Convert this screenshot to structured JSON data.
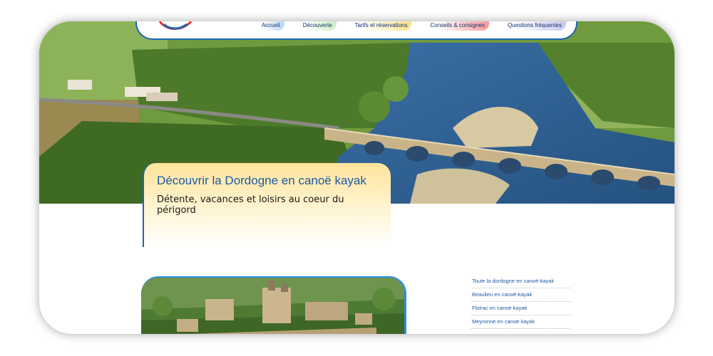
{
  "nav": {
    "items": [
      {
        "label": "Accueil",
        "key": "accueil"
      },
      {
        "label": "Découverte",
        "key": "decouverte"
      },
      {
        "label": "Tarifs et réservations",
        "key": "tarifs"
      },
      {
        "label": "Conseils & consignes",
        "key": "conseils"
      },
      {
        "label": "Questions fréquentes",
        "key": "questions"
      }
    ],
    "accent_colors": [
      "#b5d6f5",
      "#c9efc2",
      "#f8e38c",
      "#f49a9a",
      "#c9c9f2"
    ]
  },
  "hero": {
    "title": "Découvrir la Dordogne en canoë kayak",
    "subtitle": "Détente, vacances et loisirs au coeur du périgord"
  },
  "sidebar": {
    "links": [
      {
        "label": "Toute la dordogne en canoë-kayak"
      },
      {
        "label": "Beaulieu en canoë-kayak"
      },
      {
        "label": "Floirac en canoë kayak"
      },
      {
        "label": "Meyronne en canoë kayak"
      }
    ]
  },
  "colors": {
    "brand_blue": "#1e64b4",
    "title_blue": "#1e5aa8",
    "feature_border": "#2a8fe0"
  }
}
